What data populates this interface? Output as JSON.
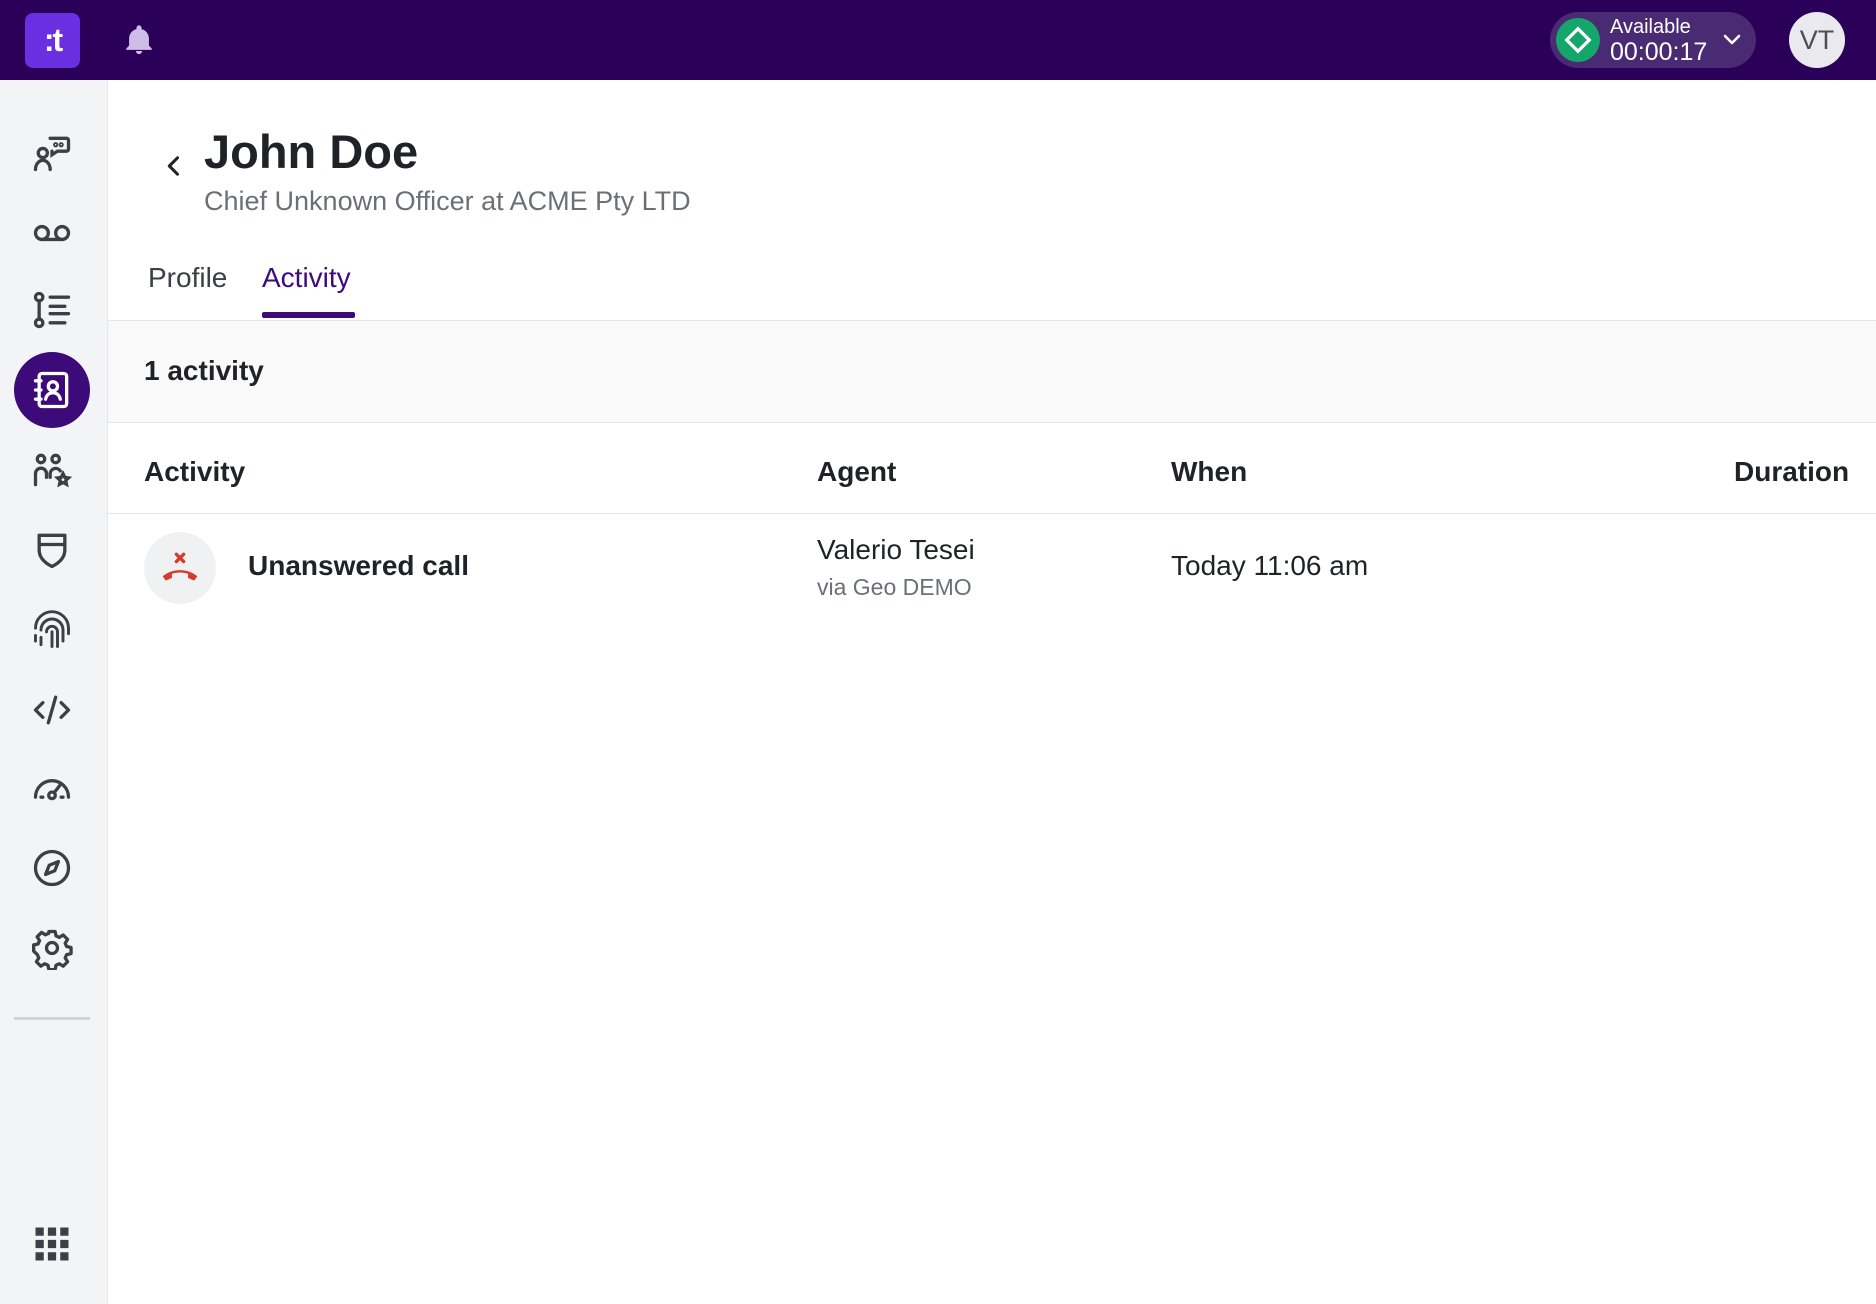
{
  "topbar": {
    "logo_text": ":t",
    "status": {
      "label": "Available",
      "timer": "00:00:17",
      "color": "#14a66b"
    },
    "avatar_initials": "VT",
    "icons": [
      "bell-icon",
      "chevron-down-icon"
    ]
  },
  "sidebar": {
    "items": [
      {
        "icon": "conversations-icon",
        "active": false
      },
      {
        "icon": "voicemail-icon",
        "active": false
      },
      {
        "icon": "flow-list-icon",
        "active": false
      },
      {
        "icon": "contacts-book-icon",
        "active": true
      },
      {
        "icon": "team-star-icon",
        "active": false
      },
      {
        "icon": "shield-icon",
        "active": false
      },
      {
        "icon": "fingerprint-icon",
        "active": false
      },
      {
        "icon": "code-icon",
        "active": false
      },
      {
        "icon": "dashboard-gauge-icon",
        "active": false
      },
      {
        "icon": "compass-icon",
        "active": false
      },
      {
        "icon": "gear-icon",
        "active": false
      }
    ],
    "bottom_icon": "apps-grid-icon",
    "accent": "#3d0a7a"
  },
  "contact": {
    "name": "John Doe",
    "subtitle": "Chief Unknown Officer at ACME Pty LTD"
  },
  "tabs": [
    {
      "label": "Profile",
      "active": false
    },
    {
      "label": "Activity",
      "active": true
    }
  ],
  "summary": {
    "text": "1 activity"
  },
  "table": {
    "columns": [
      "Activity",
      "Agent",
      "When",
      "Duration"
    ],
    "rows": [
      {
        "type": "Unanswered call",
        "icon": "missed-call-icon",
        "agent": "Valerio Tesei",
        "via": "via Geo DEMO",
        "when": "Today 11:06 am",
        "duration": ""
      }
    ]
  }
}
